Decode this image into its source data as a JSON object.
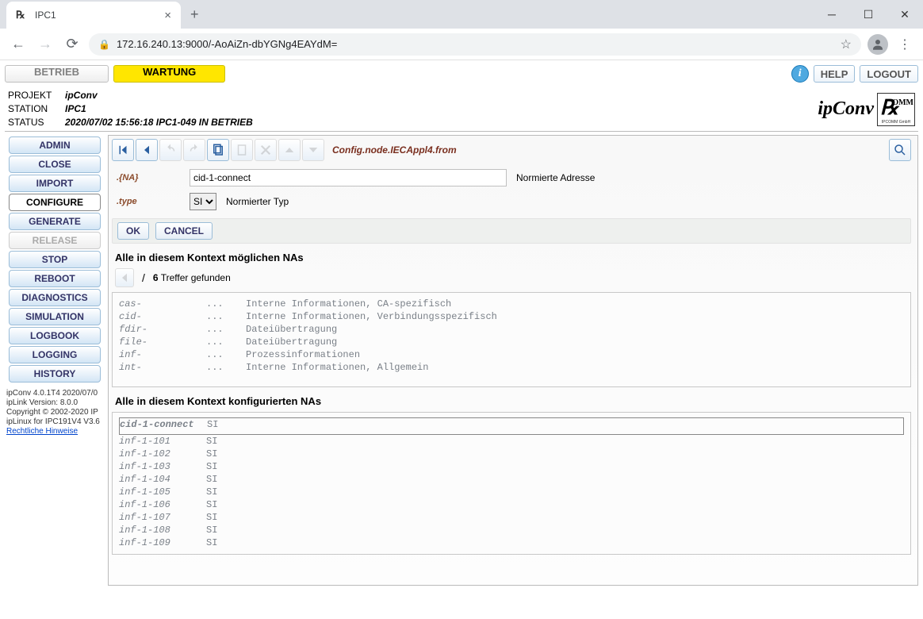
{
  "browser": {
    "tab_title": "IPC1",
    "url": "172.16.240.13:9000/-AoAiZn-dbYGNg4EAYdM="
  },
  "top": {
    "mode_betrieb": "BETRIEB",
    "mode_wartung": "WARTUNG",
    "help": "HELP",
    "logout": "LOGOUT"
  },
  "status": {
    "projekt_label": "PROJEKT",
    "projekt_val": "ipConv",
    "station_label": "STATION",
    "station_val": "IPC1",
    "status_label": "STATUS",
    "status_val": "2020/07/02 15:56:18 IPC1-049 IN BETRIEB",
    "brand": "ipConv",
    "brand_sub": "IPCOMM GmbH"
  },
  "sidebar": {
    "items": [
      {
        "label": "ADMIN",
        "cls": ""
      },
      {
        "label": "CLOSE",
        "cls": ""
      },
      {
        "label": "IMPORT",
        "cls": ""
      },
      {
        "label": "CONFIGURE",
        "cls": "plain"
      },
      {
        "label": "GENERATE",
        "cls": ""
      },
      {
        "label": "RELEASE",
        "cls": "disabled"
      },
      {
        "label": "STOP",
        "cls": ""
      },
      {
        "label": "REBOOT",
        "cls": ""
      },
      {
        "label": "DIAGNOSTICS",
        "cls": ""
      },
      {
        "label": "SIMULATION",
        "cls": ""
      },
      {
        "label": "LOGBOOK",
        "cls": ""
      },
      {
        "label": "LOGGING",
        "cls": ""
      },
      {
        "label": "HISTORY",
        "cls": ""
      }
    ],
    "footer": {
      "l1": "ipConv 4.0.1T4 2020/07/0",
      "l2": "ipLink Version: 8.0.0",
      "l3": "Copyright © 2002-2020 IP",
      "l4": "ipLinux for IPC191V4 V3.6",
      "link": "Rechtliche Hinweise"
    }
  },
  "toolbar": {
    "path": "Config.node.IECAppl4.from"
  },
  "form": {
    "na_label": ".{NA}",
    "na_value": "cid-1-connect",
    "na_desc": "Normierte Adresse",
    "type_label": ".type",
    "type_value": "SI",
    "type_desc": "Normierter Typ",
    "ok": "OK",
    "cancel": "CANCEL"
  },
  "section1": {
    "title": "Alle in diesem Kontext möglichen NAs",
    "count": "6",
    "count_suffix": "Treffer gefunden",
    "rows": [
      {
        "a": "cas-",
        "b": "...",
        "c": "Interne Informationen, CA-spezifisch"
      },
      {
        "a": "cid-",
        "b": "...",
        "c": "Interne Informationen, Verbindungsspezifisch"
      },
      {
        "a": "fdir-",
        "b": "...",
        "c": "Dateiübertragung"
      },
      {
        "a": "file-",
        "b": "...",
        "c": "Dateiübertragung"
      },
      {
        "a": "inf-",
        "b": "...",
        "c": "Prozessinformationen"
      },
      {
        "a": "int-",
        "b": "...",
        "c": "Interne Informationen, Allgemein"
      }
    ]
  },
  "section2": {
    "title": "Alle in diesem Kontext konfigurierten NAs",
    "rows": [
      {
        "a": "cid-1-connect",
        "b": "SI",
        "sel": true
      },
      {
        "a": "inf-1-101",
        "b": "SI"
      },
      {
        "a": "inf-1-102",
        "b": "SI"
      },
      {
        "a": "inf-1-103",
        "b": "SI"
      },
      {
        "a": "inf-1-104",
        "b": "SI"
      },
      {
        "a": "inf-1-105",
        "b": "SI"
      },
      {
        "a": "inf-1-106",
        "b": "SI"
      },
      {
        "a": "inf-1-107",
        "b": "SI"
      },
      {
        "a": "inf-1-108",
        "b": "SI"
      },
      {
        "a": "inf-1-109",
        "b": "SI"
      }
    ]
  }
}
